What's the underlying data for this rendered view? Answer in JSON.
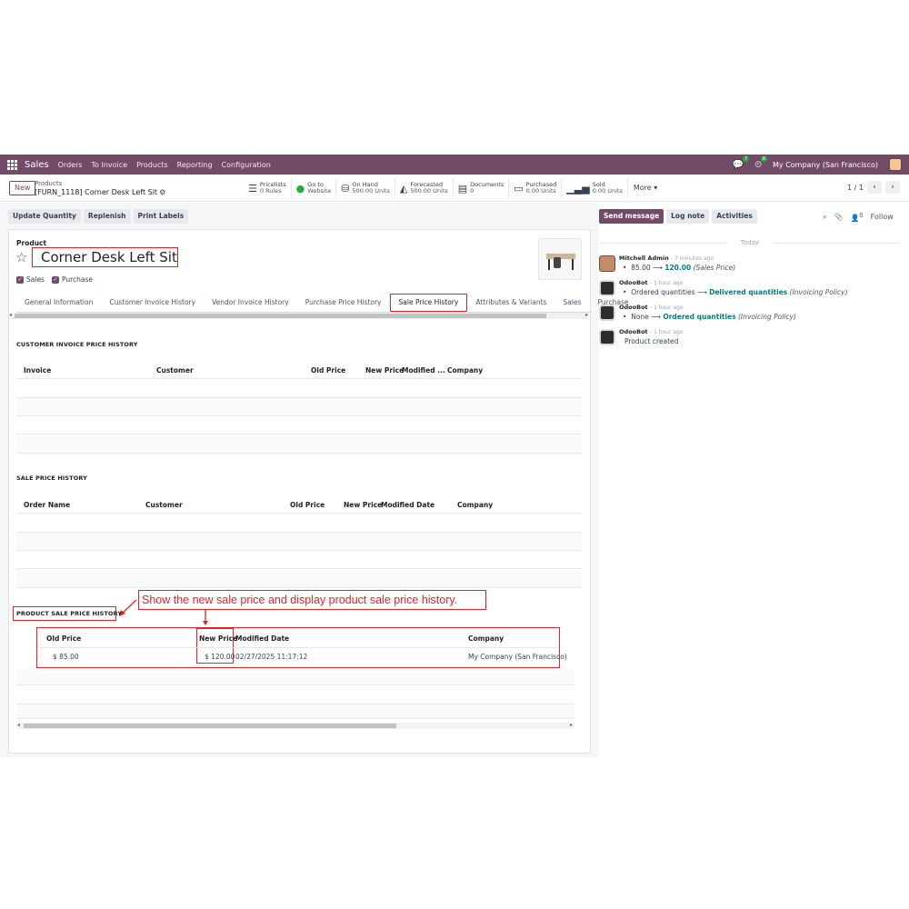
{
  "navbar": {
    "app_name": "Sales",
    "menu": [
      "Orders",
      "To Invoice",
      "Products",
      "Reporting",
      "Configuration"
    ],
    "chat_badge": "7",
    "activity_badge": "8",
    "company": "My Company (San Francisco)"
  },
  "control": {
    "new_label": "New",
    "breadcrumb_parent": "Products",
    "breadcrumb_current": "[FURN_1118] Corner Desk Left Sit",
    "smart_buttons": [
      {
        "label": "Pricelists",
        "value": "0 Rules"
      },
      {
        "label": "Go to",
        "value": "Website"
      },
      {
        "label": "On Hand",
        "value": "500.00 Units"
      },
      {
        "label": "Forecasted",
        "value": "500.00 Units"
      },
      {
        "label": "Documents",
        "value": "0"
      },
      {
        "label": "Purchased",
        "value": "0.00 Units"
      },
      {
        "label": "Sold",
        "value": "0.00 Units"
      }
    ],
    "more_label": "More ▾",
    "pager": "1 / 1"
  },
  "statusbar": {
    "update_quantity": "Update Quantity",
    "replenish": "Replenish",
    "print_labels": "Print Labels"
  },
  "form": {
    "product_label": "Product",
    "product_name": "Corner Desk Left Sit",
    "sales_label": "Sales",
    "purchase_label": "Purchase",
    "tabs": [
      "General Information",
      "Customer Invoice History",
      "Vendor Invoice History",
      "Purchase Price History",
      "Sale Price History",
      "Attributes & Variants",
      "Sales",
      "Purchase"
    ],
    "active_tab": "Sale Price History"
  },
  "customer_invoice_history": {
    "title": "CUSTOMER INVOICE PRICE HISTORY",
    "columns": [
      "Invoice",
      "Customer",
      "Old Price",
      "New Price",
      "Modified ...",
      "Company"
    ]
  },
  "sale_price_history": {
    "title": "SALE PRICE HISTORY",
    "columns": [
      "Order Name",
      "Customer",
      "Old Price",
      "New Price",
      "Modified Date",
      "Company"
    ]
  },
  "product_sale_price_history": {
    "title": "PRODUCT SALE PRICE HISTORY",
    "columns": [
      "Old Price",
      "New Price",
      "Modified Date",
      "Company"
    ],
    "rows": [
      {
        "old_price": "$ 85.00",
        "new_price": "$ 120.00",
        "modified_date": "02/27/2025 11:17:12",
        "company": "My Company (San Francisco)"
      }
    ]
  },
  "annotation": "Show the new sale price and display product sale price history.",
  "chatter": {
    "send_message": "Send message",
    "log_note": "Log note",
    "activities": "Activities",
    "attachments_count": "0",
    "follow": "Follow",
    "today": "Today",
    "messages": [
      {
        "author": "Mitchell Admin",
        "time": "- 7 minutes ago",
        "old": "85.00",
        "new": "120.00",
        "field": "(Sales Price)"
      },
      {
        "author": "OdooBot",
        "time": "- 1 hour ago",
        "old": "Ordered quantities",
        "new": "Delivered quantities",
        "field": "(Invoicing Policy)"
      },
      {
        "author": "OdooBot",
        "time": "- 1 hour ago",
        "old": "None",
        "new": "Ordered quantities",
        "field": "(Invoicing Policy)"
      },
      {
        "author": "OdooBot",
        "time": "- 1 hour ago",
        "text": "Product created"
      }
    ]
  }
}
